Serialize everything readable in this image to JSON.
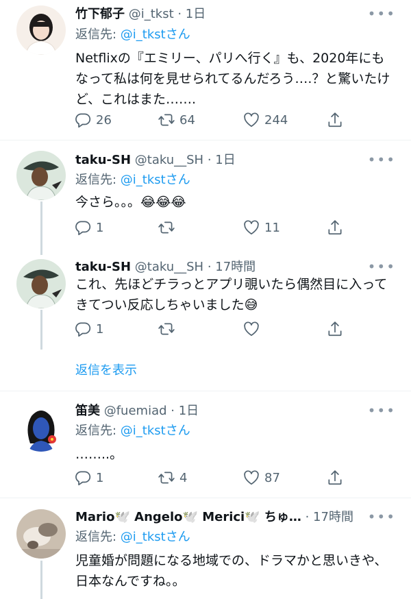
{
  "tweets": [
    {
      "name": "竹下郁子",
      "meta": " @i_tkst · 1日",
      "reply_label": "返信先: ",
      "reply_handle": "@i_tkstさん",
      "text": "Netflixの『エミリー、パリへ行く』も、2020年にもなって私は何を見せられてるんだろう….？と驚いたけど、これはまた…….",
      "replies": "26",
      "retweets": "64",
      "likes": "244"
    },
    {
      "name": "taku-SH",
      "meta": " @taku__SH · 1日",
      "reply_label": "返信先: ",
      "reply_handle": "@i_tkstさん",
      "text": "今さら。。。😂😂😂",
      "replies": "1",
      "retweets": "",
      "likes": "11"
    },
    {
      "name": "taku-SH",
      "meta": " @taku__SH · 17時間",
      "text": "これ、先ほどチラっとアプリ覗いたら偶然目に入ってきてつい反応しちゃいました😅",
      "replies": "1",
      "retweets": "",
      "likes": ""
    },
    {
      "name": "笛美",
      "meta": " @fuemiad · 1日",
      "reply_label": "返信先: ",
      "reply_handle": "@i_tkstさん",
      "text": "……..。",
      "replies": "1",
      "retweets": "4",
      "likes": "87"
    },
    {
      "name": "Mario🕊️ Angelo🕊️ Merici🕊️ ちゅ…",
      "meta": " · 17時間",
      "reply_label": "返信先: ",
      "reply_handle": "@i_tkstさん",
      "text": "児童婚が問題になる地域での、ドラマかと思いきや、日本なんですね。。"
    }
  ],
  "show_replies": "返信を表示",
  "more_glyph": "•••",
  "icons": [
    "reply-icon",
    "retweet-icon",
    "like-icon",
    "share-icon",
    "more-icon"
  ],
  "colors": {
    "link": "#1d9bf0",
    "secondary": "#536471",
    "separator": "#eff3f4"
  }
}
